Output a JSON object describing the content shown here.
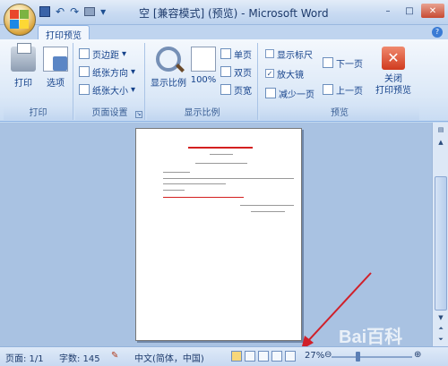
{
  "app": {
    "title": "空 [兼容模式] (预览) - Microsoft Word"
  },
  "quick_access": {
    "save_icon": "save-icon",
    "undo_glyph": "↶",
    "redo_glyph": "↷"
  },
  "window_controls": {
    "minimize": "–",
    "maximize": "□",
    "close": "✕"
  },
  "tabs": [
    {
      "label": "打印预览",
      "active": true
    }
  ],
  "help_glyph": "?",
  "ribbon": {
    "print_group": {
      "label": "打印",
      "print": "打印",
      "options": "选项"
    },
    "page_setup_group": {
      "label": "页面设置",
      "margins": "页边距",
      "orientation": "纸张方向",
      "size": "纸张大小"
    },
    "zoom_group": {
      "label": "显示比例",
      "zoom": "显示比例",
      "hundred": "100%",
      "one_page": "单页",
      "two_pages": "双页",
      "page_width": "页宽"
    },
    "preview_group": {
      "label": "预览",
      "show_ruler": "显示标尺",
      "magnifier": "放大镜",
      "shrink_one_page": "减少一页",
      "next_page": "下一页",
      "prev_page": "上一页",
      "close_preview": "关闭\n打印预览"
    },
    "show_ruler_checked": false,
    "magnifier_checked": true
  },
  "status": {
    "page": "页面: 1/1",
    "words": "字数: 145",
    "language": "中文(简体，中国)",
    "zoom": "27%"
  },
  "colors": {
    "arrow": "#d0202a",
    "doc_title_red": "#d42020"
  },
  "watermark": "Bai百科"
}
